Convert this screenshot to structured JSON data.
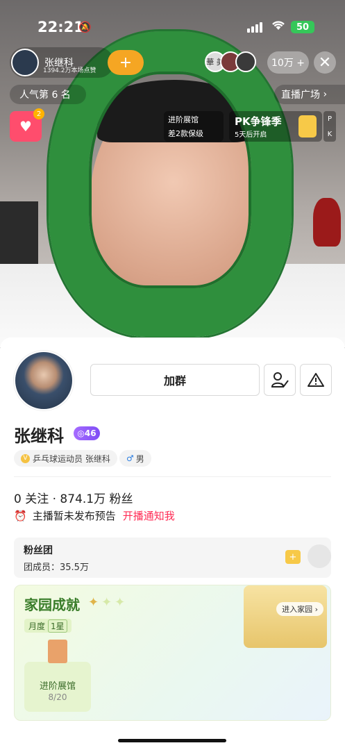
{
  "status_bar": {
    "time": "22:21",
    "battery": "50"
  },
  "live": {
    "host_name": "张继科",
    "host_sub": "1394.2万本场点赞",
    "viewer_avatar_text": "華 美",
    "viewer_count": "10万 +",
    "rank": "人气第 6 名",
    "plaza": "直播广场",
    "gift_badge": "2",
    "card_advance": {
      "title": "进阶展馆",
      "sub": "差2款保级"
    },
    "card_pk": {
      "title": "PK争锋季",
      "sub": "5天后开启",
      "side": [
        "P",
        "K"
      ]
    }
  },
  "profile": {
    "add_button": "加群",
    "name": "张继科",
    "level": "46",
    "tags": [
      "乒乓球运动员 张继科",
      "男"
    ],
    "stats": "0 关注 · 874.1万 粉丝",
    "notice": "主播暂未发布预告",
    "notify_link": "开播通知我"
  },
  "fans_club": {
    "title": "粉丝团",
    "members": "团成员：35.5万"
  },
  "home": {
    "title": "家园成就",
    "month_label": "月度",
    "month_value": "1星",
    "enter": "进入家园",
    "tile_label": "进阶展馆",
    "tile_progress": "8/20",
    "tile_progress_fraction": 0.4
  },
  "colors": {
    "accent": "#ff2c55",
    "level": "#7f4df5",
    "home_green": "#3a7d2a"
  }
}
